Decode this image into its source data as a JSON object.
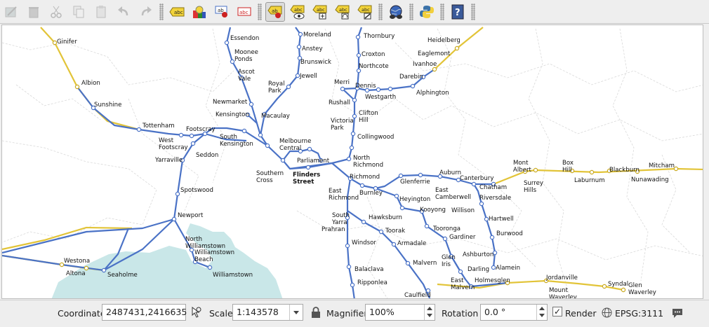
{
  "status": {
    "coordinate_label": "Coordinate",
    "coordinate_value": "2487431,2416635",
    "scale_label": "Scale",
    "scale_value": "1:143578",
    "magnifier_label": "Magnifier",
    "magnifier_value": "100%",
    "rotation_label": "Rotation",
    "rotation_value": "0.0 °",
    "render_label": "Render",
    "render_checked": "✓",
    "crs_label": "EPSG:3111"
  },
  "map": {
    "colors": {
      "metro": "#4a72c6",
      "regional": "#e2c438",
      "water": "#c9e7e8",
      "boundary": "#d6d6d6"
    },
    "stations": [
      "Ginifer",
      "Albion",
      "Sunshine",
      "Tottenham",
      "West Footscray",
      "Footscray",
      "Seddon",
      "Yarraville",
      "Spotswood",
      "Newport",
      "North Williamstown",
      "Williamstown Beach",
      "Williamstown",
      "Westona",
      "Altona",
      "Seaholme",
      "Essendon",
      "Moonee Ponds",
      "Ascot Vale",
      "Newmarket",
      "Kensington",
      "Macaulay",
      "Royal Park",
      "Jewell",
      "Brunswick",
      "Anstey",
      "Moreland",
      "South Kensington",
      "Melbourne Central",
      "Parliament",
      "Southern Cross",
      "Flinders Street",
      "Thornbury",
      "Croxton",
      "Northcote",
      "Merri",
      "Rushall",
      "Dennis",
      "Westgarth",
      "Clifton Hill",
      "Victoria Park",
      "Collingwood",
      "North Richmond",
      "Richmond",
      "East Richmond",
      "Burnley",
      "Heidelberg",
      "Eaglemont",
      "Ivanhoe",
      "Darebin",
      "Alphington",
      "Glenferrie",
      "Auburn",
      "Heyington",
      "Kooyong",
      "Canterbury",
      "East Camberwell",
      "Chatham",
      "Riversdale",
      "Mont Albert",
      "Surrey Hills",
      "Box Hill",
      "Laburnum",
      "Blackburn",
      "Nunawading",
      "Mitcham",
      "Willison",
      "Hartwell",
      "Burwood",
      "Tooronga",
      "Gardiner",
      "Glen Iris",
      "Ashburton",
      "Alamein",
      "Darling",
      "East Malvern",
      "Holmesglen",
      "Jordanville",
      "Mount Waverley",
      "Syndal",
      "Glen Waverley",
      "South Yarra",
      "Hawksburn",
      "Toorak",
      "Prahran",
      "Armadale",
      "Windsor",
      "Malvern",
      "Balaclava",
      "Ripponlea",
      "Caulfield"
    ]
  }
}
